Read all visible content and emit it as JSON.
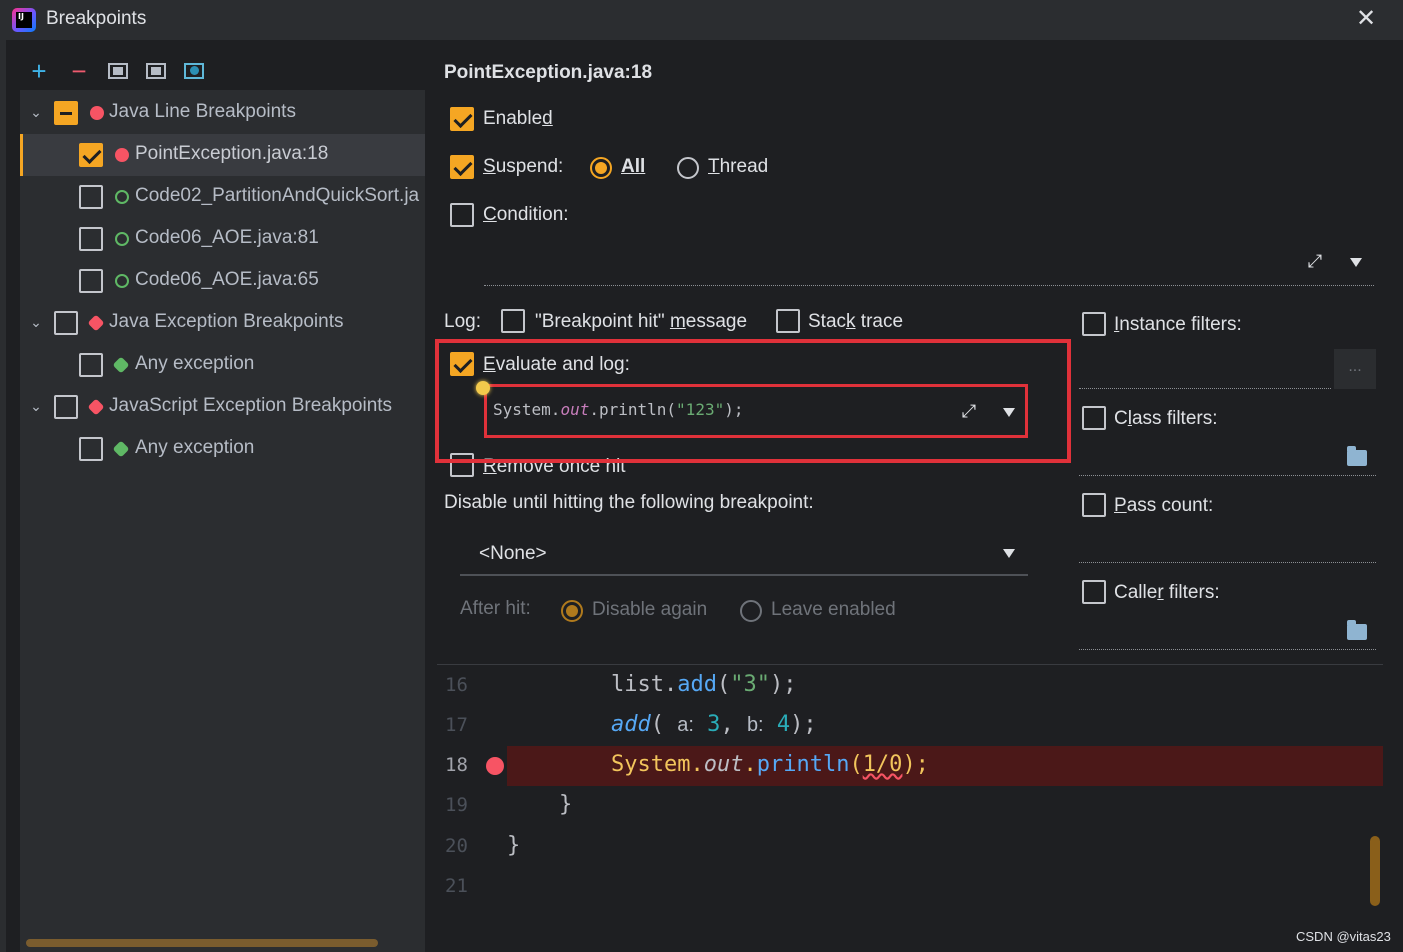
{
  "window": {
    "title": "Breakpoints",
    "close": "✕",
    "app_icon": "intellij-idea-icon"
  },
  "toolbar": {
    "add": "+",
    "remove": "−",
    "icons": [
      "add-icon",
      "remove-icon",
      "group-by-package-icon",
      "group-by-file-icon",
      "group-by-class-icon"
    ]
  },
  "tree": {
    "groups": [
      {
        "label": "Java Line Breakpoints",
        "state": "partial",
        "icon": "red-dot-icon",
        "items": [
          {
            "label": "PointException.java:18",
            "checked": true,
            "selected": true,
            "icon": "red-dot-icon"
          },
          {
            "label": "Code02_PartitionAndQuickSort.ja",
            "checked": false,
            "icon": "hollow-green-dot-icon"
          },
          {
            "label": "Code06_AOE.java:81",
            "checked": false,
            "icon": "hollow-green-dot-icon"
          },
          {
            "label": "Code06_AOE.java:65",
            "checked": false,
            "icon": "hollow-green-dot-icon"
          }
        ]
      },
      {
        "label": "Java Exception Breakpoints",
        "state": "unchecked",
        "icon": "exception-red-icon",
        "items": [
          {
            "label": "Any exception",
            "checked": false,
            "icon": "exception-green-icon"
          }
        ]
      },
      {
        "label": "JavaScript Exception Breakpoints",
        "state": "unchecked",
        "icon": "exception-red-icon",
        "items": [
          {
            "label": "Any exception",
            "checked": false,
            "icon": "exception-green-icon"
          }
        ]
      }
    ]
  },
  "details": {
    "title": "PointException.java:18",
    "enabled": {
      "pre": "Enable",
      "u": "d",
      "post": "",
      "checked": true
    },
    "suspend": {
      "pre": "",
      "u": "S",
      "post": "uspend:",
      "checked": true
    },
    "suspend_all": {
      "pre": "",
      "u": "All",
      "post": "",
      "selected": true
    },
    "suspend_thread": {
      "pre": "",
      "u": "T",
      "post": "hread",
      "selected": false
    },
    "condition": {
      "pre": "",
      "u": "C",
      "post": "ondition:",
      "checked": false
    },
    "log_label": "Log:",
    "log_message": {
      "pre": "\"Breakpoint hit\" ",
      "u": "m",
      "post": "essage",
      "checked": false
    },
    "stack_trace": {
      "pre": "Stac",
      "u": "k",
      "post": " trace",
      "checked": false
    },
    "evaluate_and_log": {
      "pre": "",
      "u": "E",
      "post": "valuate and log:",
      "checked": true
    },
    "eval_expr": {
      "a": "System.",
      "b": "out",
      "c": ".println(",
      "d": "\"123\"",
      "e": ");"
    },
    "remove_once_hit": {
      "pre": "",
      "u": "R",
      "post": "emove once hit",
      "checked": false
    },
    "disable_until": "Disable until hitting the following breakpoint:",
    "disable_select": "<None>",
    "after_hit": "After hit:",
    "disable_again": "Disable again",
    "leave_enabled": "Leave enabled"
  },
  "filters": {
    "instance": {
      "pre": "",
      "u": "I",
      "post": "nstance filters:",
      "checked": false
    },
    "more": "...",
    "class": {
      "pre": "C",
      "u": "l",
      "post": "ass filters:",
      "checked": false
    },
    "pass": {
      "pre": "",
      "u": "P",
      "post": "ass count:",
      "checked": false
    },
    "caller": {
      "pre": "Calle",
      "u": "r",
      "post": " filters:",
      "checked": false
    }
  },
  "editor": {
    "lines": [
      {
        "num": "16"
      },
      {
        "num": "17"
      },
      {
        "num": "18",
        "highlighted": true,
        "breakpoint": true
      },
      {
        "num": "19"
      },
      {
        "num": "20"
      },
      {
        "num": "21"
      }
    ],
    "l16": {
      "a": "list.",
      "b": "add",
      "c": "(",
      "d": "\"3\"",
      "e": ");"
    },
    "l17": {
      "a": "add",
      "b": "( ",
      "c": "a:",
      "d": " 3",
      "e": ", ",
      "f": "b:",
      "g": " 4",
      "h": ");"
    },
    "l18": {
      "a": "System.",
      "b": "out",
      "c": ".",
      "d": "println",
      "e": "(",
      "f": "1/0",
      "g": ");"
    },
    "l19": "}",
    "l20": "}"
  },
  "colors": {
    "accent": "#f5a623",
    "highlight_outline": "#e0313a",
    "breakpoint": "#f75464",
    "current_line": "#4b1818"
  },
  "watermark": "CSDN @vitas23"
}
